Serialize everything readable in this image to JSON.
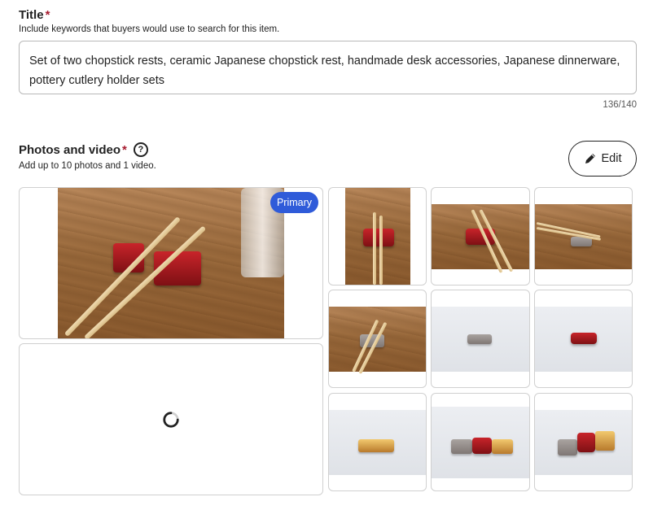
{
  "title_section": {
    "label": "Title",
    "required_mark": "*",
    "help": "Include keywords that buyers would use to search for this item.",
    "value": "Set of two chopstick rests, ceramic Japanese chopstick rest, handmade desk accessories, Japanese dinnerware, pottery cutlery holder sets",
    "char_count": "136/140"
  },
  "photos_section": {
    "label": "Photos and video",
    "required_mark": "*",
    "help_icon": "?",
    "help": "Add up to 10 photos and 1 video.",
    "edit_label": "Edit",
    "primary_badge": "Primary"
  }
}
